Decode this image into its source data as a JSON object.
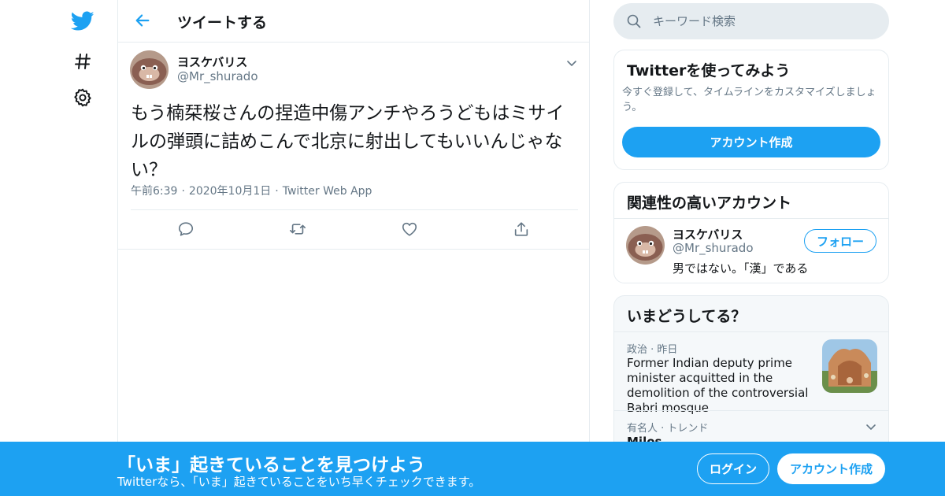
{
  "colors": {
    "accent": "#1da1f2",
    "text": "#14171a",
    "muted": "#657786",
    "border": "#e6ecf0"
  },
  "nav": {
    "icons": [
      "twitter-bird-icon",
      "hashtag-icon",
      "gear-icon"
    ]
  },
  "header": {
    "title": "ツイートする",
    "back_icon": "arrow-left-icon"
  },
  "tweet": {
    "author_name": "ヨスケバリス",
    "author_handle": "@Mr_shurado",
    "text": "もう楠栞桜さんの捏造中傷アンチやろうどもはミサイルの弾頭に詰めこんで北京に射出してもいいんじゃない？",
    "time": "午前6:39",
    "date": "2020年10月1日",
    "source": "Twitter Web App",
    "dot": "·",
    "actions": [
      "reply-icon",
      "retweet-icon",
      "like-icon",
      "share-icon"
    ]
  },
  "search": {
    "placeholder": "キーワード検索"
  },
  "signup_card": {
    "title": "Twitterを使ってみよう",
    "text": "今すぐ登録して、タイムラインをカスタマイズしましょう。",
    "button": "アカウント作成"
  },
  "relevant": {
    "title": "関連性の高いアカウント",
    "name": "ヨスケバリス",
    "handle": "@Mr_shurado",
    "bio": "男ではない。「漢」である",
    "follow": "フォロー"
  },
  "trends": {
    "title": "いまどうしてる？",
    "items": [
      {
        "meta": "政治 · 昨日",
        "headline": "Former Indian deputy prime minister acquitted in the demolition of the controversial Babri mosque"
      },
      {
        "meta": "有名人 · トレンド",
        "name": "Milos"
      }
    ]
  },
  "banner": {
    "title": "「いま」起きていることを見つけよう",
    "subtitle": "Twitterなら、「いま」起きていることをいち早くチェックできます。",
    "login": "ログイン",
    "signup": "アカウント作成"
  }
}
